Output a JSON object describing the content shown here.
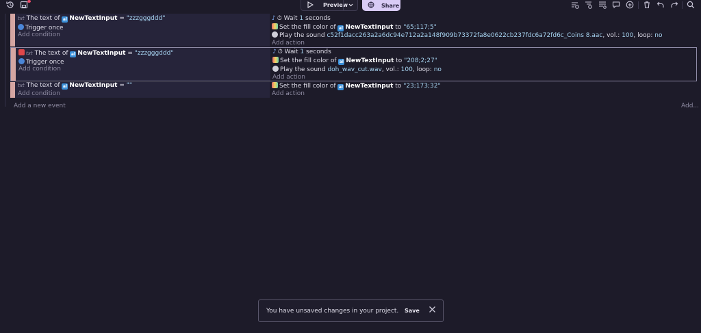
{
  "toolbar": {
    "preview_label": "Preview",
    "share_label": "Share",
    "icons": [
      "history-icon",
      "save-icon",
      "chevron-down-icon",
      "globe-icon",
      "add-event-icon",
      "add-subevent-icon",
      "add-comment-icon",
      "chat-icon",
      "add-icon",
      "delete-icon",
      "undo-icon",
      "redo-icon",
      "search-icon"
    ]
  },
  "events": [
    {
      "conditions": [
        {
          "prefix": "The text of",
          "object": "NewTextInput",
          "op": "=",
          "value": "\"zzzgggddd\""
        },
        {
          "label": "Trigger once"
        }
      ],
      "add_condition": "Add condition",
      "actions": [
        {
          "label": "Wait",
          "value": "1",
          "suffix": "seconds"
        },
        {
          "prefix": "Set the fill color of",
          "object": "NewTextInput",
          "mid": "to",
          "value": "\"65;117;5\""
        },
        {
          "prefix": "Play the sound",
          "file": "c52f1dacc263a2a6dc94e712a2a148f909b73372fa8e0622cb237fdc6a72fd6c_Coins 8.aac",
          "vol_label": ", vol.:",
          "vol": "100",
          "loop_label": ", loop:",
          "loop": "no"
        }
      ],
      "add_action": "Add action"
    },
    {
      "conditions": [
        {
          "prefix": "The text of",
          "object": "NewTextInput",
          "op": "=",
          "value": "\"zzzgggddd\""
        },
        {
          "label": "Trigger once"
        }
      ],
      "add_condition": "Add condition",
      "actions": [
        {
          "label": "Wait",
          "value": "1",
          "suffix": "seconds"
        },
        {
          "prefix": "Set the fill color of",
          "object": "NewTextInput",
          "mid": "to",
          "value": "\"208;2;27\""
        },
        {
          "prefix": "Play the sound",
          "file": "doh_wav_cut.wav",
          "vol_label": ", vol.:",
          "vol": "100",
          "loop_label": ", loop:",
          "loop": "no"
        }
      ],
      "add_action": "Add action"
    },
    {
      "conditions": [
        {
          "prefix": "The text of",
          "object": "NewTextInput",
          "op": "=",
          "value": "\"\""
        }
      ],
      "add_condition": "Add condition",
      "actions": [
        {
          "prefix": "Set the fill color of",
          "object": "NewTextInput",
          "mid": "to",
          "value": "\"23;173;32\""
        }
      ],
      "add_action": "Add action"
    }
  ],
  "footer": {
    "add_event": "Add a new event",
    "add_more": "Add..."
  },
  "toast": {
    "message": "You have unsaved changes in your project.",
    "save_label": "Save"
  }
}
